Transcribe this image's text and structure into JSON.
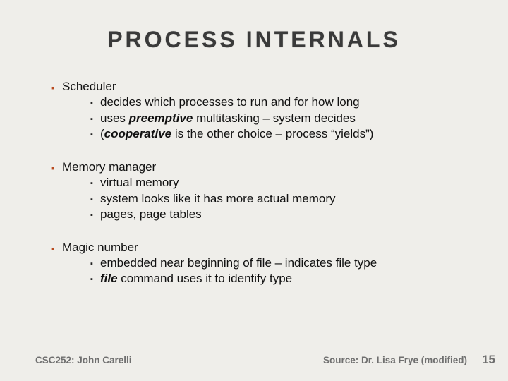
{
  "title_part1": "PROCESS",
  "title_part2": "INTERNALS",
  "sections": [
    {
      "heading": "Scheduler",
      "items": [
        "decides which processes to run and for how long",
        "uses <b class=\"em\">preemptive</b> multitasking &ndash; system decides",
        "(<b class=\"em\">cooperative</b> is the other choice &ndash; process &ldquo;yields&rdquo;)"
      ]
    },
    {
      "heading": "Memory manager",
      "items": [
        "virtual memory",
        "system looks like it has more actual memory",
        "pages, page tables"
      ]
    },
    {
      "heading": "Magic number",
      "items": [
        "embedded near beginning of file &ndash; indicates file type",
        "<b class=\"em\">file</b> command uses it to identify type"
      ]
    }
  ],
  "footer_left": "CSC252: John Carelli",
  "footer_right": "Source: Dr. Lisa Frye (modified)",
  "page_number": "15"
}
